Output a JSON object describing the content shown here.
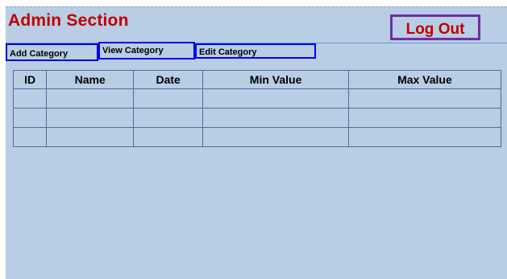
{
  "header": {
    "title": "Admin Section",
    "logout_label": "Log Out"
  },
  "tabs": [
    {
      "label": "Add Category"
    },
    {
      "label": "View Category"
    },
    {
      "label": "Edit Category"
    }
  ],
  "table": {
    "columns": [
      "ID",
      "Name",
      "Date",
      "Min Value",
      "Max Value"
    ],
    "rows": [
      [
        "",
        "",
        "",
        "",
        ""
      ],
      [
        "",
        "",
        "",
        "",
        ""
      ],
      [
        "",
        "",
        "",
        "",
        ""
      ]
    ]
  },
  "colors": {
    "background": "#b9cde4",
    "title": "#c00000",
    "logout_border": "#7030a0",
    "tab_border": "#0000ff",
    "grid_line": "#4f6f9c"
  }
}
